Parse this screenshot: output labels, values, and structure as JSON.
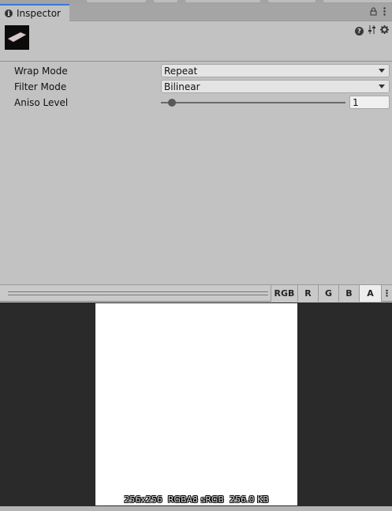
{
  "tab": {
    "label": "Inspector"
  },
  "properties": [
    {
      "label": "Wrap Mode",
      "value": "Repeat"
    },
    {
      "label": "Filter Mode",
      "value": "Bilinear"
    },
    {
      "label": "Aniso Level",
      "value": "1",
      "slider_fraction": 0.06
    }
  ],
  "channels": [
    "RGB",
    "R",
    "G",
    "B",
    "A"
  ],
  "active_channel": "A",
  "preview": {
    "info": "256x256  RGBA8 sRGB  256.0 KB"
  },
  "icons": {
    "tab": "info-icon",
    "header": [
      "help-icon",
      "sliders-icon",
      "gear-icon"
    ],
    "tabbar": [
      "lock-icon",
      "kebab-icon"
    ]
  }
}
